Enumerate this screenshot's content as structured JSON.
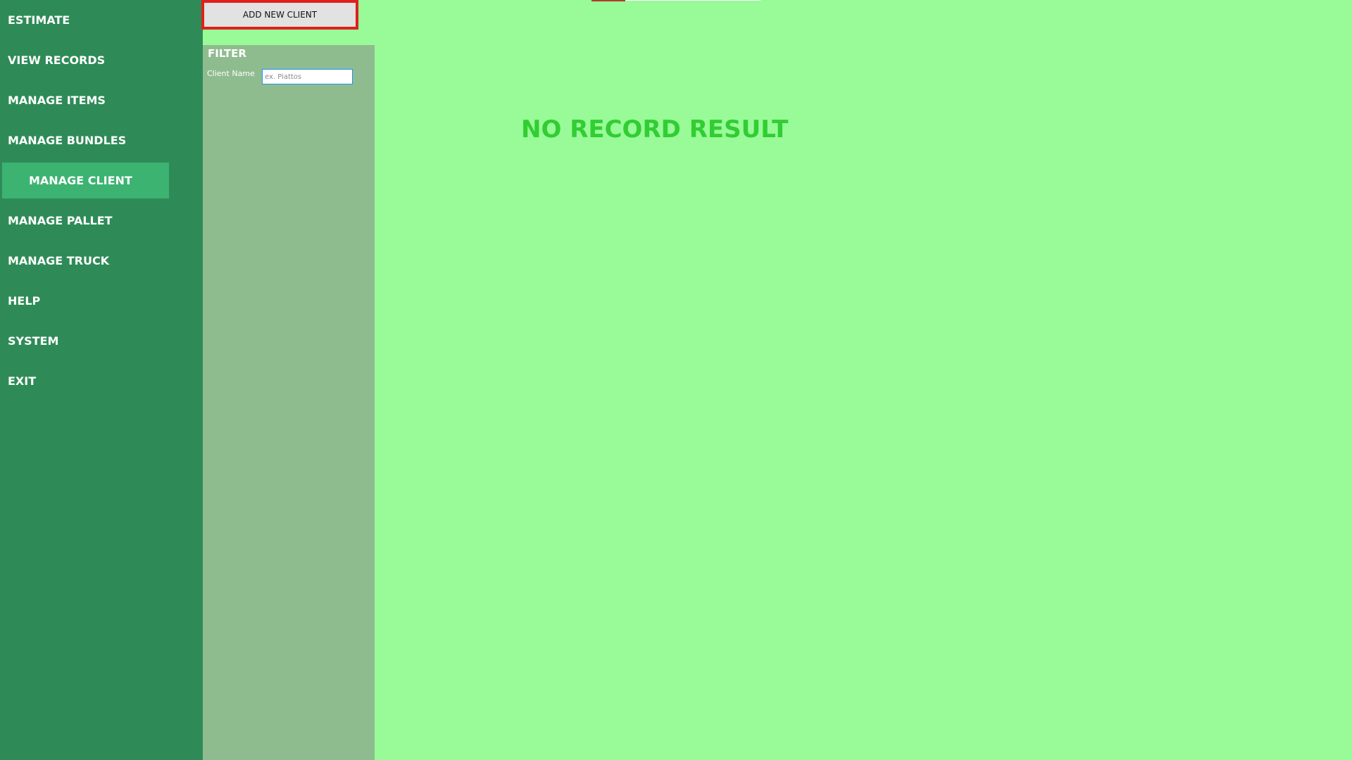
{
  "sidebar": {
    "items": [
      {
        "label": "ESTIMATE"
      },
      {
        "label": "VIEW RECORDS"
      },
      {
        "label": "MANAGE ITEMS"
      },
      {
        "label": "MANAGE BUNDLES"
      },
      {
        "label": "MANAGE CLIENT",
        "active": true
      },
      {
        "label": "MANAGE PALLET"
      },
      {
        "label": "MANAGE TRUCK"
      },
      {
        "label": "HELP"
      },
      {
        "label": "SYSTEM"
      },
      {
        "label": "EXIT"
      }
    ]
  },
  "toolbar": {
    "add_label": "ADD NEW CLIENT"
  },
  "filter": {
    "title": "FILTER",
    "client_name_label": "Client Name",
    "client_name_value": "",
    "client_name_placeholder": "ex. Piattos"
  },
  "main": {
    "empty_message": "NO RECORD RESULT"
  },
  "colors": {
    "sidebar_bg": "#2e8b57",
    "sidebar_active_bg": "#3cb371",
    "filter_panel_bg": "#8fbc8f",
    "content_bg": "#98fb98",
    "empty_message": "#32cd32",
    "highlight_border": "#e0201c"
  }
}
